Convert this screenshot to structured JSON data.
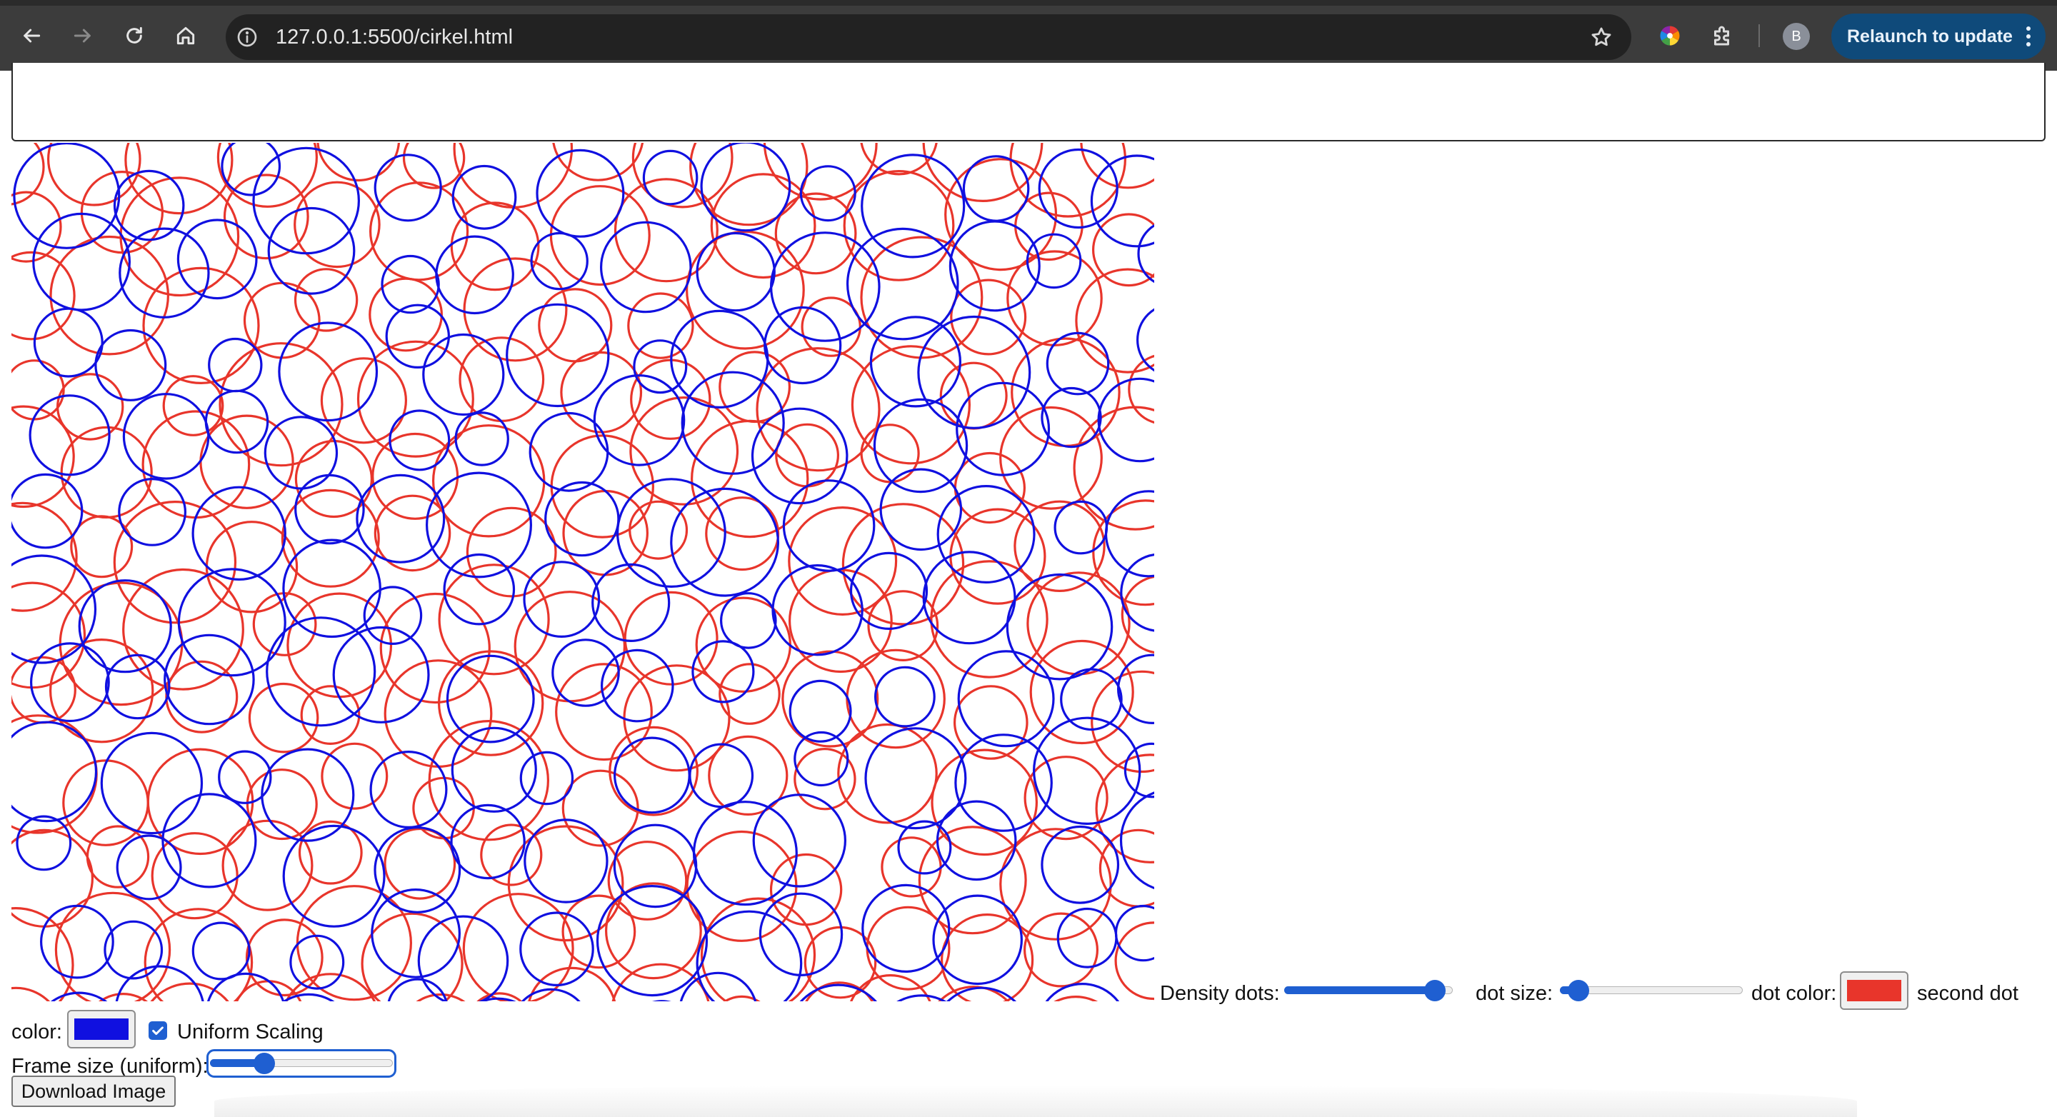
{
  "browser": {
    "url": "127.0.0.1:5500/cirkel.html",
    "profile_initial": "B",
    "relaunch_label": "Relaunch to update",
    "icons": [
      "back-arrow-icon",
      "forward-arrow-icon",
      "reload-icon",
      "home-icon",
      "site-info-icon",
      "bookmark-star-icon",
      "color-wheel-extension-icon",
      "extensions-puzzle-icon",
      "more-vertical-icon"
    ]
  },
  "colors": {
    "dot_color": "#e8352b",
    "second_dot_color": "#1010e0",
    "accent": "#1f5fd1"
  },
  "controls": {
    "density_label": "Density dots:",
    "density_value": 0.95,
    "dot_size_label": "dot size:",
    "dot_size_value": 0.05,
    "dot_color_label": "dot color:",
    "second_dot_color_label_1": "second dot",
    "second_dot_color_label_2": "color:",
    "uniform_scaling_label": "Uniform Scaling",
    "uniform_scaling_checked": true,
    "frame_size_label": "Frame size (uniform):",
    "frame_size_value": 0.27,
    "download_label": "Download Image"
  }
}
